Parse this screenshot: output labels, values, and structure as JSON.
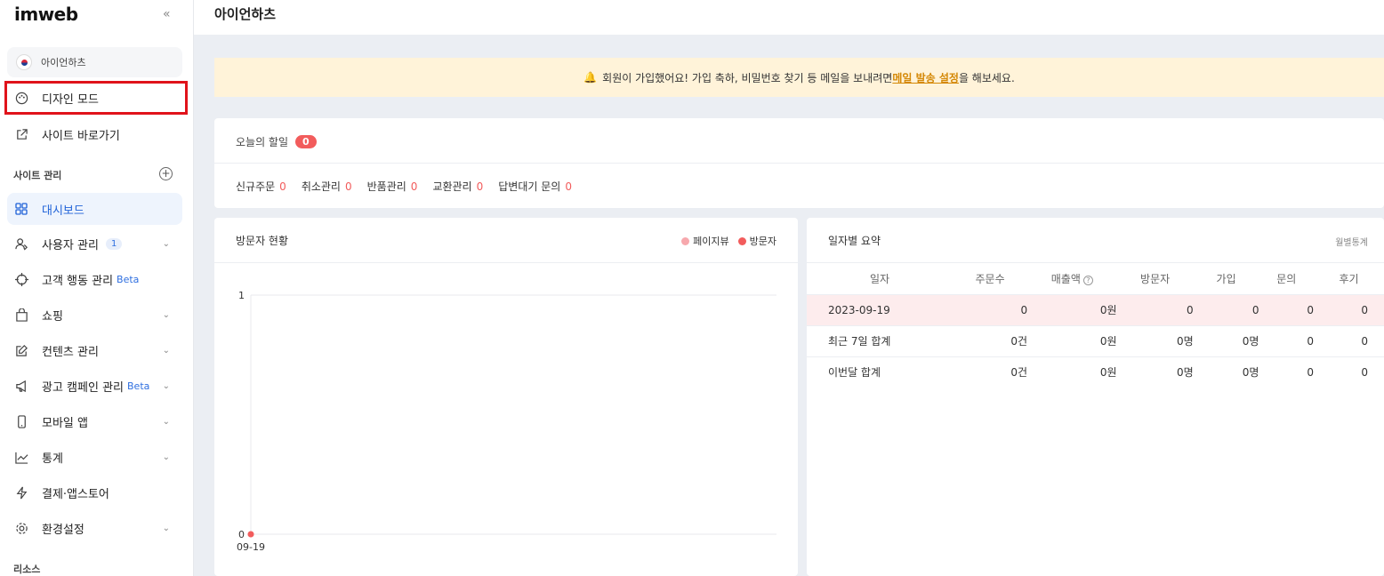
{
  "sidebar": {
    "logo": "imweb",
    "collapse": "«",
    "site_name": "아이언하츠",
    "design_mode": "디자인 모드",
    "site_link": "사이트 바로가기",
    "section_manage": "사이트 관리",
    "items": [
      {
        "label": "대시보드",
        "icon": "grid-icon"
      },
      {
        "label": "사용자 관리",
        "icon": "users-icon",
        "count": "1"
      },
      {
        "label": "고객 행동 관리",
        "icon": "target-icon",
        "beta": "Beta"
      },
      {
        "label": "쇼핑",
        "icon": "bag-icon"
      },
      {
        "label": "컨텐츠 관리",
        "icon": "edit-icon"
      },
      {
        "label": "광고 캠페인 관리",
        "icon": "megaphone-icon",
        "beta": "Beta"
      },
      {
        "label": "모바일 앱",
        "icon": "mobile-icon"
      },
      {
        "label": "통계",
        "icon": "chart-icon"
      },
      {
        "label": "결제·앱스토어",
        "icon": "bolt-icon"
      },
      {
        "label": "환경설정",
        "icon": "gear-icon"
      }
    ],
    "section_resource": "리소스"
  },
  "topbar": {
    "title": "아이언하츠"
  },
  "notice": {
    "before": "회원이 가입했어요! 가입 축하, 비밀번호 찾기 등 메일을 보내려면 ",
    "link": "메일 발송 설정",
    "after": "을 해보세요."
  },
  "today": {
    "title": "오늘의 할일",
    "count": "0",
    "stats": [
      {
        "label": "신규주문",
        "value": "0"
      },
      {
        "label": "취소관리",
        "value": "0"
      },
      {
        "label": "반품관리",
        "value": "0"
      },
      {
        "label": "교환관리",
        "value": "0"
      },
      {
        "label": "답변대기 문의",
        "value": "0"
      }
    ]
  },
  "visitor": {
    "title": "방문자 현황",
    "legend": [
      {
        "label": "페이지뷰",
        "color": "#f7a8ad"
      },
      {
        "label": "방문자",
        "color": "#f25c5c"
      }
    ]
  },
  "chart_data": {
    "type": "line",
    "x": [
      "09-19"
    ],
    "series": [
      {
        "name": "페이지뷰",
        "values": [
          0
        ]
      },
      {
        "name": "방문자",
        "values": [
          0
        ]
      }
    ],
    "ylim": [
      0,
      1
    ],
    "yticks": [
      "1",
      "0"
    ]
  },
  "summary": {
    "title": "일자별 요약",
    "monthly": "월별통계",
    "columns": [
      "일자",
      "주문수",
      "매출액",
      "방문자",
      "가입",
      "문의",
      "후기"
    ],
    "rows": [
      [
        "2023-09-19",
        "0",
        "0원",
        "0",
        "0",
        "0",
        "0"
      ],
      [
        "최근 7일 합계",
        "0건",
        "0원",
        "0명",
        "0명",
        "0",
        "0"
      ],
      [
        "이번달 합계",
        "0건",
        "0원",
        "0명",
        "0명",
        "0",
        "0"
      ]
    ]
  }
}
